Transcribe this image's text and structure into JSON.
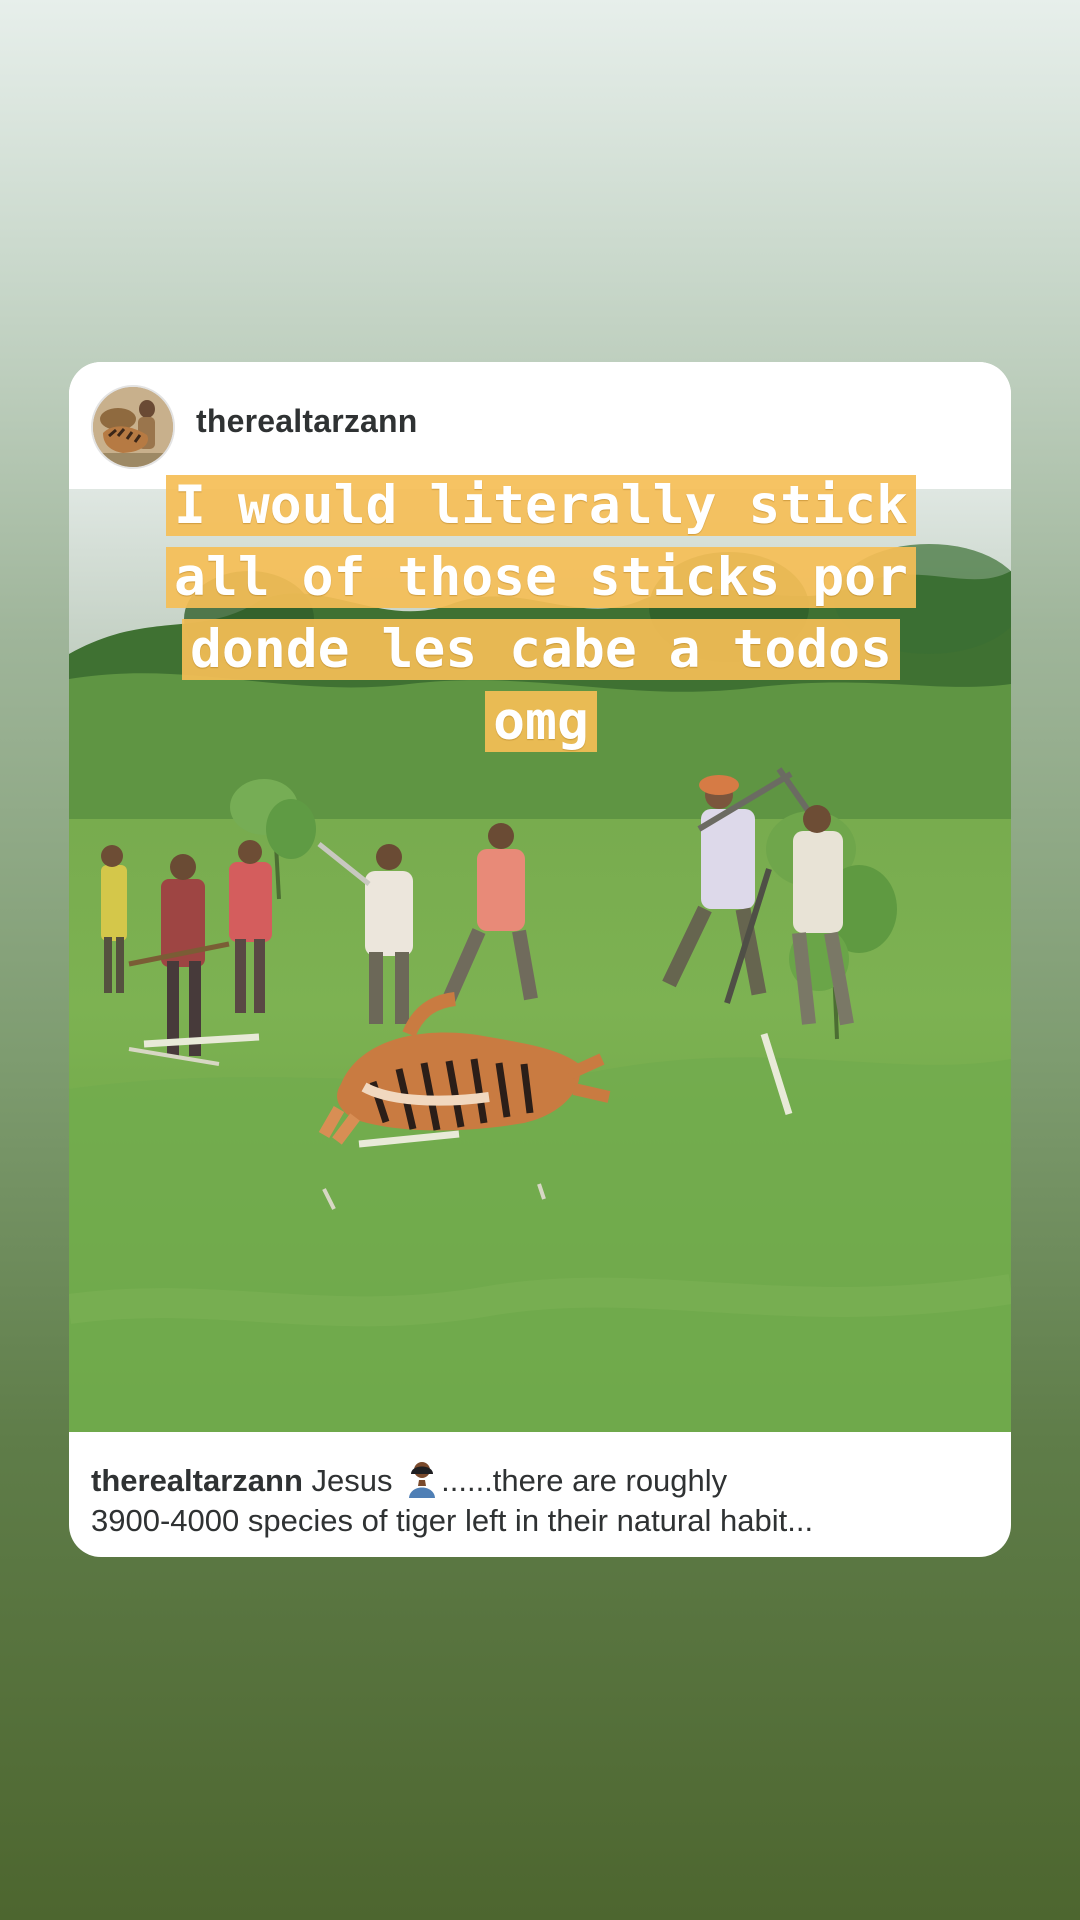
{
  "post": {
    "username": "therealtarzann",
    "caption_user": "therealtarzann",
    "caption_line1_before_emoji": " Jesus ",
    "caption_emoji": "person-emoji",
    "caption_line1_after_emoji": "......there are roughly",
    "caption_line2": "3900-4000 species of tiger left in their natural habit..."
  },
  "overlay": {
    "line1": "I would literally stick",
    "line2": "all of those sticks por",
    "line3": "donde les cabe a todos",
    "line4": "omg",
    "highlight_color": "#f5be56"
  }
}
